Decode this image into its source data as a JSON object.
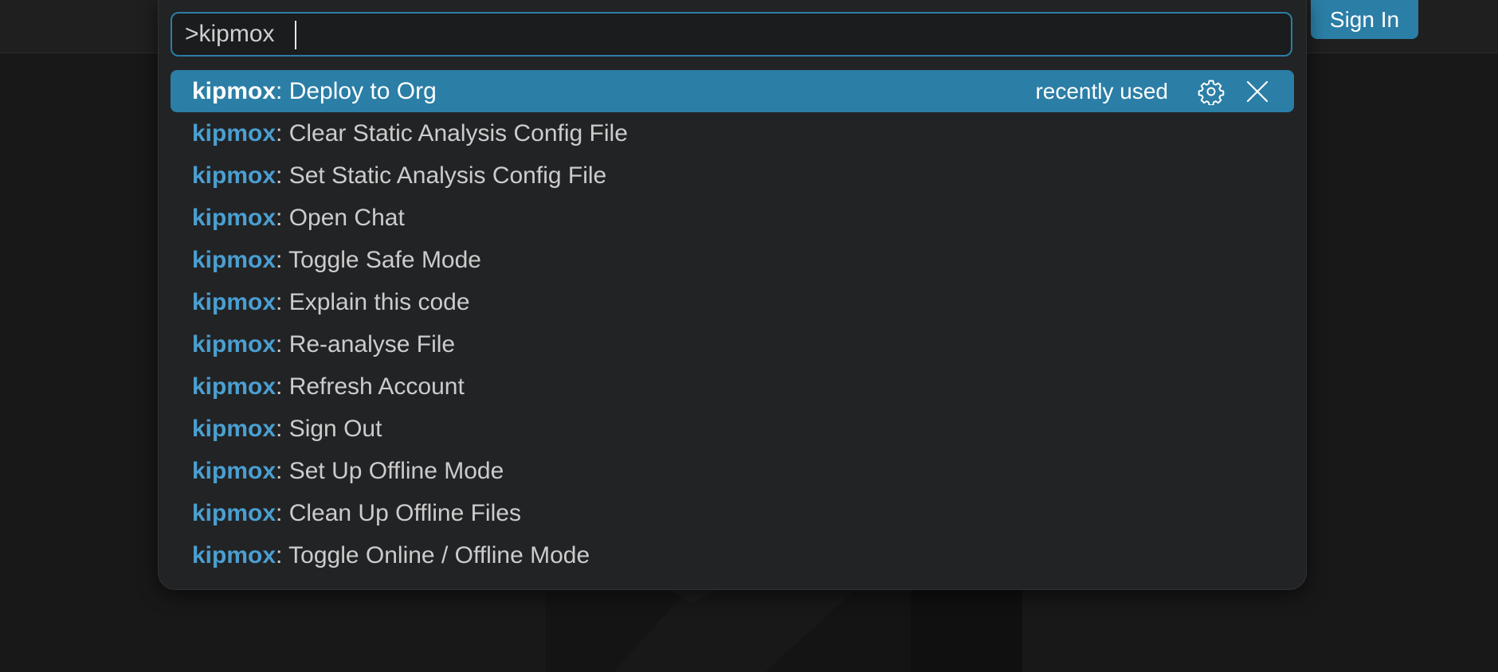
{
  "titlebar": {
    "sign_in_label": "Sign In"
  },
  "palette": {
    "input_value": ">kipmox",
    "selected_hint": "recently used",
    "results": [
      {
        "prefix": "kipmox",
        "label": ": Deploy to Org"
      },
      {
        "prefix": "kipmox",
        "label": ": Clear Static Analysis Config File"
      },
      {
        "prefix": "kipmox",
        "label": ": Set Static Analysis Config File"
      },
      {
        "prefix": "kipmox",
        "label": ": Open Chat"
      },
      {
        "prefix": "kipmox",
        "label": ": Toggle Safe Mode"
      },
      {
        "prefix": "kipmox",
        "label": ": Explain this code"
      },
      {
        "prefix": "kipmox",
        "label": ": Re-analyse File"
      },
      {
        "prefix": "kipmox",
        "label": ": Refresh Account"
      },
      {
        "prefix": "kipmox",
        "label": ": Sign Out"
      },
      {
        "prefix": "kipmox",
        "label": ": Set Up Offline Mode"
      },
      {
        "prefix": "kipmox",
        "label": ": Clean Up Offline Files"
      },
      {
        "prefix": "kipmox",
        "label": ": Toggle Online / Offline Mode"
      }
    ],
    "selected_index": 0
  },
  "icons": {
    "settings": "gear-icon",
    "remove": "close-icon"
  },
  "colors": {
    "accent": "#2b7ea6",
    "highlight_text": "#4a9fd1",
    "palette_bg": "#222325",
    "editor_bg": "#181818"
  }
}
